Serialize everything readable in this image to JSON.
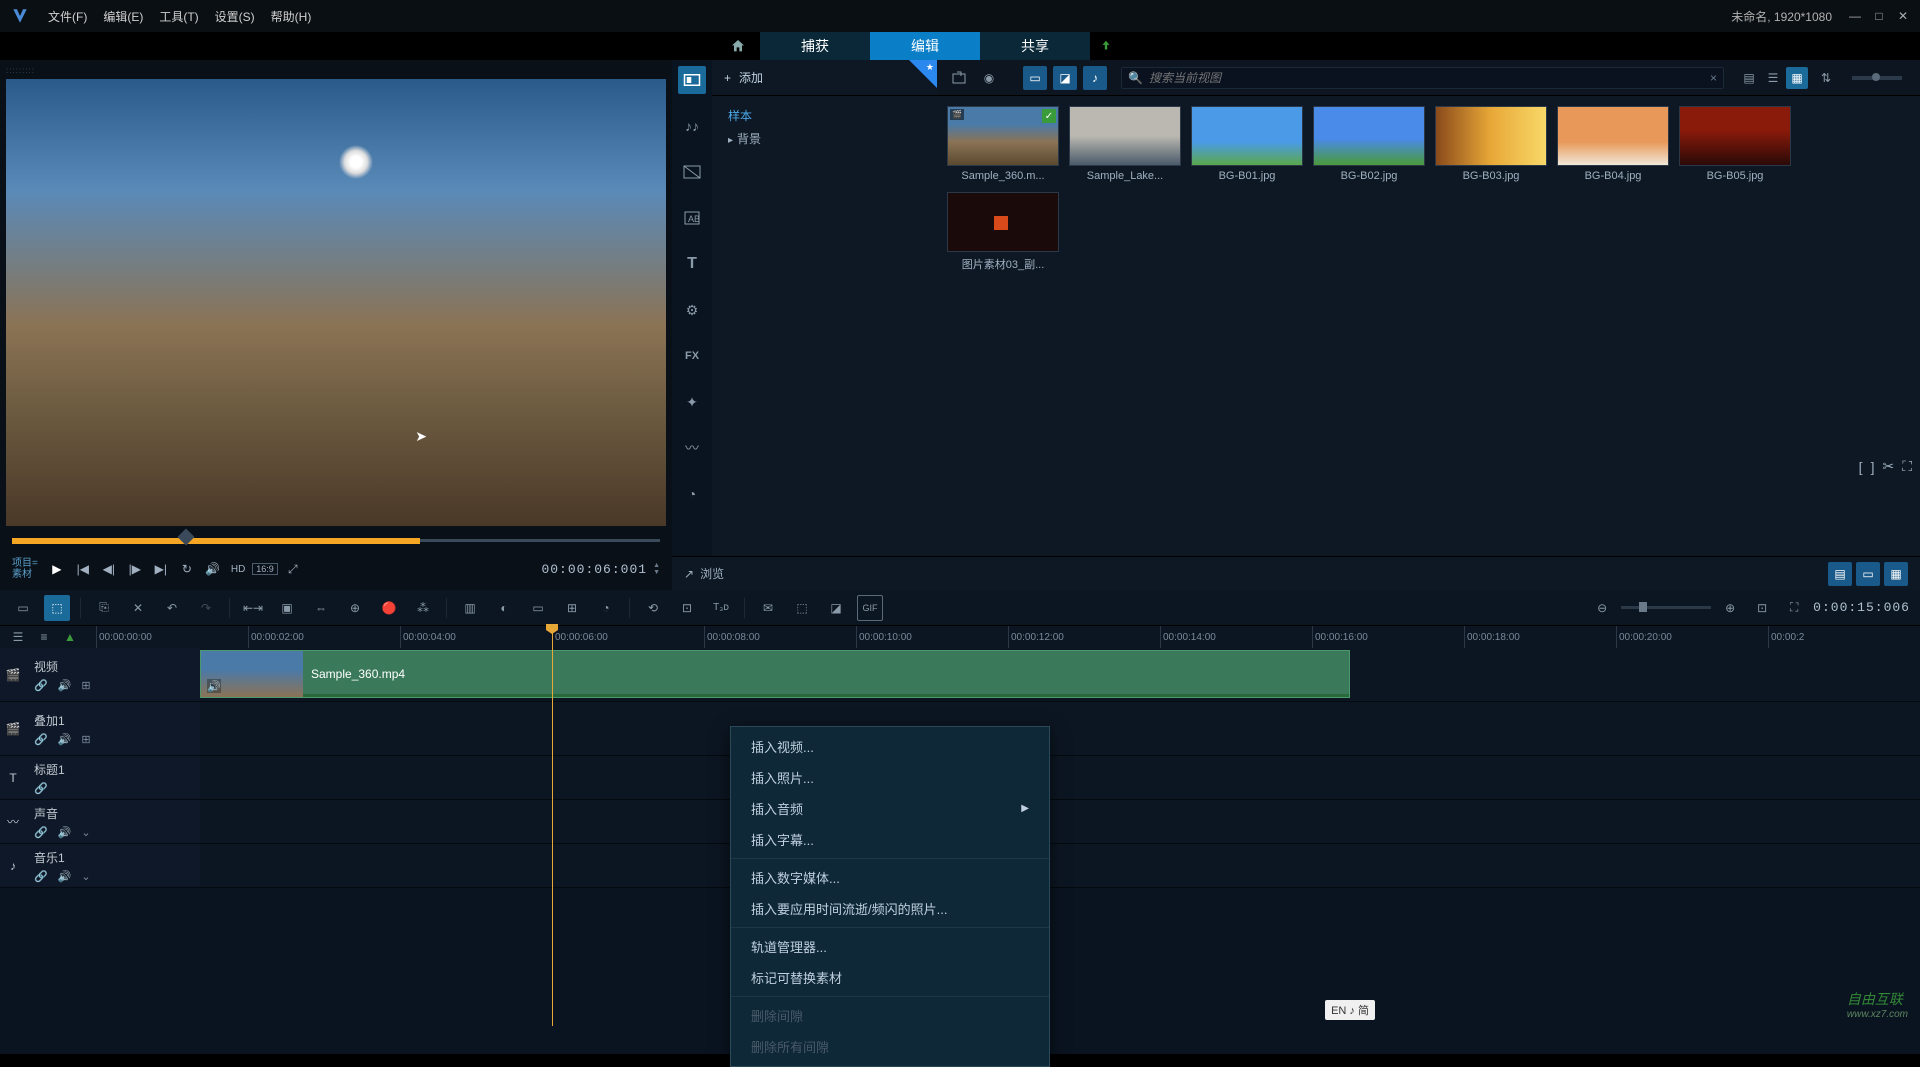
{
  "titlebar": {
    "menus": [
      "文件(F)",
      "编辑(E)",
      "工具(T)",
      "设置(S)",
      "帮助(H)"
    ],
    "project_info": "未命名, 1920*1080"
  },
  "main_tabs": {
    "capture": "捕获",
    "edit": "编辑",
    "share": "共享"
  },
  "preview": {
    "project_label": "项目=",
    "material_label": "素材",
    "hd": "HD",
    "aspect": "16:9",
    "timecode": "00:00:06:001"
  },
  "library": {
    "add_label": "添加",
    "tree": {
      "sample": "样本",
      "background": "背景"
    },
    "search_placeholder": "搜索当前视图",
    "items": [
      "Sample_360.m...",
      "Sample_Lake...",
      "BG-B01.jpg",
      "BG-B02.jpg",
      "BG-B03.jpg",
      "BG-B04.jpg",
      "BG-B05.jpg",
      "图片素材03_副..."
    ],
    "browse": "浏览"
  },
  "timeline": {
    "current_time": "0:00:15:006",
    "ruler": [
      "00:00:00:00",
      "00:00:02:00",
      "00:00:04:00",
      "00:00:06:00",
      "00:00:08:00",
      "00:00:10:00",
      "00:00:12:00",
      "00:00:14:00",
      "00:00:16:00",
      "00:00:18:00",
      "00:00:20:00",
      "00:00:2"
    ],
    "tracks": {
      "video": "视频",
      "overlay": "叠加1",
      "title": "标题1",
      "sound": "声音",
      "music": "音乐1"
    },
    "clip_name": "Sample_360.mp4"
  },
  "context_menu": {
    "insert_video": "插入视频...",
    "insert_photo": "插入照片...",
    "insert_audio": "插入音频",
    "insert_subtitle": "插入字幕...",
    "insert_digital": "插入数字媒体...",
    "insert_timelapse": "插入要应用时间流逝/频闪的照片...",
    "track_manager": "轨道管理器...",
    "mark_replaceable": "标记可替换素材",
    "delete_gap": "删除间隙",
    "delete_all_gaps": "删除所有间隙"
  },
  "lang_indicator": "EN ♪ 简",
  "watermark": {
    "main": "自由互联",
    "sub": "www.xz7.com"
  }
}
